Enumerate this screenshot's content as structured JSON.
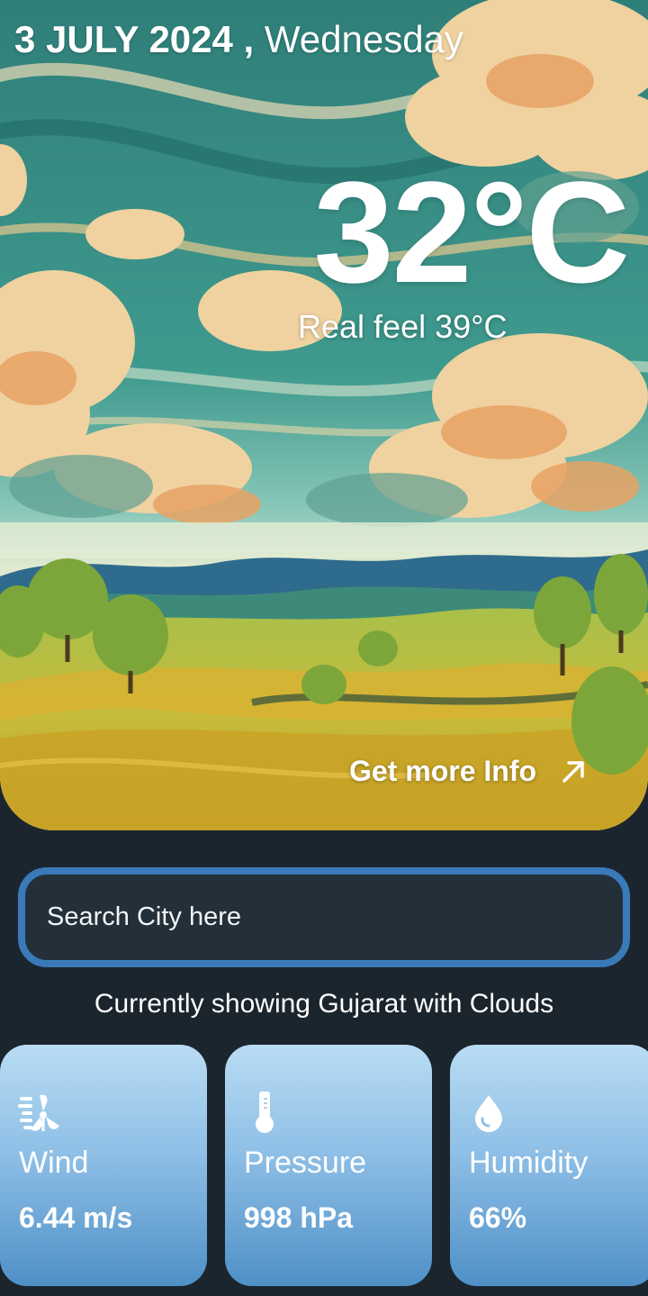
{
  "header": {
    "date": "3 JULY 2024",
    "separator": " ,",
    "weekday": "Wednesday"
  },
  "weather": {
    "temperature": "32°C",
    "real_feel": "Real feel 39°C"
  },
  "more_info": {
    "label": "Get more Info",
    "icon": "arrow-up-right-icon"
  },
  "search": {
    "placeholder": "Search City here",
    "value": ""
  },
  "status_text": "Currently showing Gujarat with Clouds",
  "cards": [
    {
      "label": "Wind",
      "value": "6.44 m/s",
      "icon": "wind-turbine-icon"
    },
    {
      "label": "Pressure",
      "value": "998 hPa",
      "icon": "thermometer-icon"
    },
    {
      "label": "Humidity",
      "value": "66%",
      "icon": "water-drop-icon"
    }
  ],
  "colors": {
    "background": "#1b252e",
    "search_border": "#3b7ab8",
    "card_top": "#b9dcf3",
    "card_bottom": "#4f90c7",
    "sky": "#2f8a83",
    "field": "#c6b83a"
  }
}
